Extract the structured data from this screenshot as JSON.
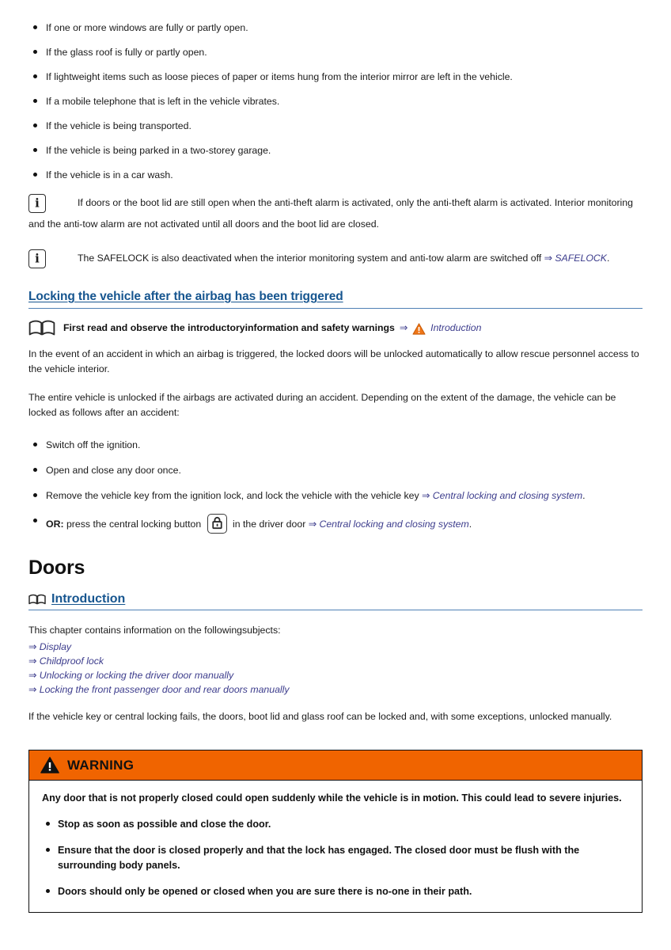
{
  "alarm_conditions": {
    "items": [
      "If one or more windows are fully or partly open.",
      "If the glass roof is fully or partly open.",
      "If lightweight items such as loose pieces of paper or items hung from the interior mirror are left in the vehicle.",
      "If a mobile telephone that is left in the vehicle vibrates.",
      "If the vehicle is being transported.",
      "If the vehicle is being parked in a two-storey garage.",
      "If the vehicle is in a car wash."
    ]
  },
  "notes": [
    {
      "icon": "info-icon",
      "text": "If doors or the boot lid are still open when the anti-theft alarm is activated, only the anti-theft alarm is activated. Interior monitoring and the anti-tow alarm are not activated until all doors and the boot lid are closed."
    },
    {
      "icon": "info-icon",
      "text_before": "The SAFELOCK is also deactivated when the interior monitoring system and anti-tow alarm are switched off ",
      "arrow": "⇒",
      "link": "SAFELOCK",
      "text_after": "."
    }
  ],
  "airbag_section": {
    "heading": "Locking the vehicle after the airbag has been triggered",
    "read_first": {
      "book_icon": "open-book-icon",
      "bold_text": "First read and observe the introductoryinformation and safety warnings",
      "arrow": "⇒",
      "warning_icon": "warning-triangle-icon",
      "link": "Introduction"
    },
    "paragraph_1": "In the event of an accident in which an airbag is triggered, the locked doors will be unlocked automatically to allow rescue personnel access to the vehicle interior.",
    "paragraph_2": "The entire vehicle is unlocked if the airbags are activated during an accident. Depending on the extent of the damage, the vehicle can be locked as follows after an accident:",
    "steps": [
      {
        "text": "Switch off the ignition."
      },
      {
        "text": "Open and close any door once."
      },
      {
        "text_before": "Remove the vehicle key from the ignition lock, and lock the vehicle with the vehicle key ",
        "arrow": "⇒",
        "link": "Central locking and closing system",
        "text_after": "."
      },
      {
        "bold_prefix": "OR:",
        "text_before": " press the central locking button ",
        "inline_icon": "lock-button-icon",
        "text_middle": " in the driver door ",
        "arrow": "⇒",
        "link": "Central locking and closing system",
        "text_after": "."
      }
    ]
  },
  "doors_chapter": {
    "title": "Doors",
    "intro_heading": {
      "icon": "open-book-icon",
      "label": "Introduction"
    },
    "intro_lead": "This chapter contains information on the followingsubjects:",
    "xref_items": [
      {
        "arrow": "⇒",
        "link": "Display"
      },
      {
        "arrow": "⇒",
        "link": "Childproof lock"
      },
      {
        "arrow": "⇒",
        "link": "Unlocking or locking the driver door manually"
      },
      {
        "arrow": "⇒",
        "link": "Locking the front passenger door and rear doors manually"
      }
    ],
    "closing_paragraph": "If the vehicle key or central locking fails, the doors, boot lid and glass roof can be locked and, with some exceptions, unlocked manually."
  },
  "warning_box": {
    "icon": "warning-triangle-icon",
    "label": "WARNING",
    "lead": "Any door that is not properly closed could open suddenly while the vehicle is in motion. This could lead to severe injuries.",
    "items": [
      "Stop as soon as possible and close the door.",
      "Ensure that the door is closed properly and that the lock has engaged. The closed door must be flush with the surrounding body panels.",
      "Doors should only be opened or closed when you are sure there is no-one in their path."
    ]
  },
  "colors": {
    "heading_blue": "#16558f",
    "link_blue": "#3c3c8c",
    "warning_orange": "#f06400",
    "rule_blue": "#4f80b5",
    "text_black": "#1a1a1a"
  }
}
